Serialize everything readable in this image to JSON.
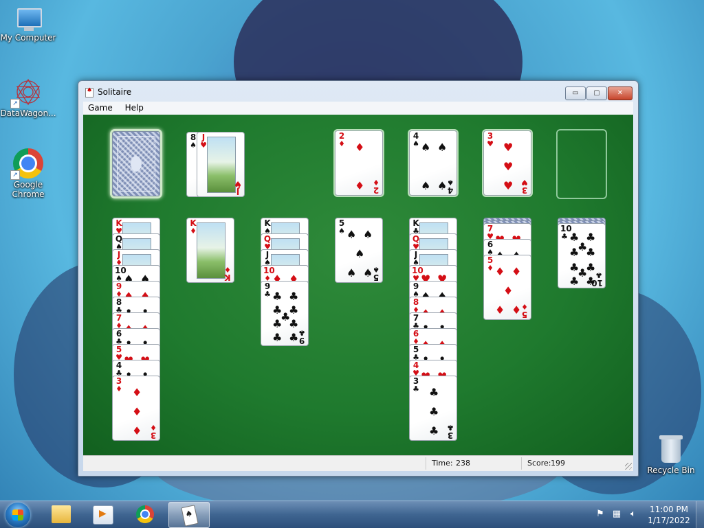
{
  "desktop": {
    "icons": [
      {
        "label": "My Computer"
      },
      {
        "label": "DataWagon..."
      },
      {
        "label": "Google Chrome"
      },
      {
        "label": "Recycle Bin"
      }
    ]
  },
  "window": {
    "title": "Solitaire",
    "menu": [
      "Game",
      "Help"
    ],
    "controls": {
      "minimize": "▭",
      "maximize": "▢",
      "close": "✕"
    },
    "status": {
      "time_label": "Time:",
      "time": "238",
      "score_label": "Score:",
      "score": "199"
    }
  },
  "game": {
    "stock": {
      "face_down": true
    },
    "waste": [
      {
        "rank": "8",
        "suit": "♠",
        "color": "black"
      },
      {
        "rank": "J",
        "suit": "♥",
        "color": "red"
      }
    ],
    "foundations": [
      {
        "rank": "2",
        "suit": "♦",
        "color": "red"
      },
      {
        "rank": "4",
        "suit": "♠",
        "color": "black"
      },
      {
        "rank": "3",
        "suit": "♥",
        "color": "red"
      },
      null
    ],
    "tableau": [
      {
        "face_down": 0,
        "cards": [
          {
            "rank": "K",
            "suit": "♥",
            "color": "red"
          },
          {
            "rank": "Q",
            "suit": "♠",
            "color": "black"
          },
          {
            "rank": "J",
            "suit": "♦",
            "color": "red"
          },
          {
            "rank": "10",
            "suit": "♠",
            "color": "black"
          },
          {
            "rank": "9",
            "suit": "♦",
            "color": "red"
          },
          {
            "rank": "8",
            "suit": "♣",
            "color": "black"
          },
          {
            "rank": "7",
            "suit": "♦",
            "color": "red"
          },
          {
            "rank": "6",
            "suit": "♣",
            "color": "black"
          },
          {
            "rank": "5",
            "suit": "♥",
            "color": "red"
          },
          {
            "rank": "4",
            "suit": "♣",
            "color": "black"
          },
          {
            "rank": "3",
            "suit": "♦",
            "color": "red"
          }
        ]
      },
      {
        "face_down": 0,
        "cards": [
          {
            "rank": "K",
            "suit": "♦",
            "color": "red"
          }
        ]
      },
      {
        "face_down": 0,
        "cards": [
          {
            "rank": "K",
            "suit": "♠",
            "color": "black"
          },
          {
            "rank": "Q",
            "suit": "♥",
            "color": "red"
          },
          {
            "rank": "J",
            "suit": "♠",
            "color": "black"
          },
          {
            "rank": "10",
            "suit": "♦",
            "color": "red"
          },
          {
            "rank": "9",
            "suit": "♣",
            "color": "black"
          }
        ]
      },
      {
        "face_down": 0,
        "cards": [
          {
            "rank": "5",
            "suit": "♠",
            "color": "black"
          }
        ]
      },
      {
        "face_down": 0,
        "cards": [
          {
            "rank": "K",
            "suit": "♣",
            "color": "black"
          },
          {
            "rank": "Q",
            "suit": "♥",
            "color": "red"
          },
          {
            "rank": "J",
            "suit": "♠",
            "color": "black"
          },
          {
            "rank": "10",
            "suit": "♥",
            "color": "red"
          },
          {
            "rank": "9",
            "suit": "♠",
            "color": "black"
          },
          {
            "rank": "8",
            "suit": "♦",
            "color": "red"
          },
          {
            "rank": "7",
            "suit": "♣",
            "color": "black"
          },
          {
            "rank": "6",
            "suit": "♦",
            "color": "red"
          },
          {
            "rank": "5",
            "suit": "♣",
            "color": "black"
          },
          {
            "rank": "4",
            "suit": "♥",
            "color": "red"
          },
          {
            "rank": "3",
            "suit": "♣",
            "color": "black"
          }
        ]
      },
      {
        "face_down": 2,
        "cards": [
          {
            "rank": "7",
            "suit": "♥",
            "color": "red"
          },
          {
            "rank": "6",
            "suit": "♠",
            "color": "black"
          },
          {
            "rank": "5",
            "suit": "♦",
            "color": "red"
          }
        ]
      },
      {
        "face_down": 2,
        "cards": [
          {
            "rank": "10",
            "suit": "♣",
            "color": "black"
          }
        ]
      }
    ]
  },
  "taskbar": {
    "clock_time": "11:00 PM",
    "clock_date": "1/17/2022",
    "tray_icons": [
      "flag-icon",
      "network-icon",
      "volume-icon"
    ]
  },
  "colors": {
    "felt": "#1f7a2e",
    "red_suit": "#d40e15",
    "black_suit": "#111111"
  }
}
